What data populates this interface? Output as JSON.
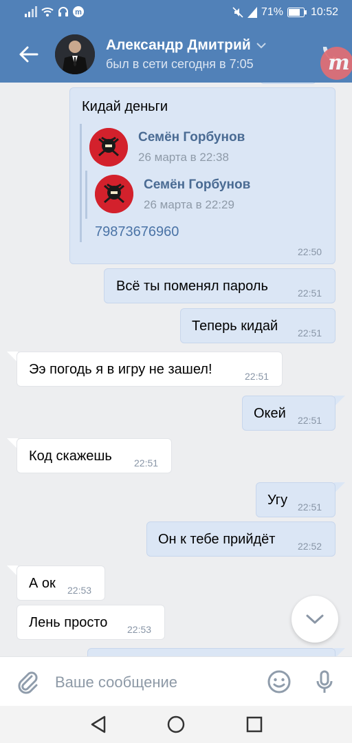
{
  "status": {
    "battery": "71%",
    "time": "10:52"
  },
  "header": {
    "title": "Александр Дмитрий",
    "subtitle": "был в сети сегодня в 7:05"
  },
  "messages": {
    "m0": {
      "text": "Кидай деньги",
      "time": "22:50",
      "forward1": {
        "name": "Семён Горбунов",
        "date": "26 марта в 22:38"
      },
      "forward2": {
        "name": "Семён Горбунов",
        "date": "26 марта в 22:29",
        "link": "79873676960"
      }
    },
    "m1": {
      "text": "Всё ты поменял пароль",
      "time": "22:51"
    },
    "m2": {
      "text": "Теперь кидай",
      "time": "22:51"
    },
    "m3": {
      "text": "Ээ погодь я в игру не зашел!",
      "time": "22:51"
    },
    "m4": {
      "text": "Окей",
      "time": "22:51"
    },
    "m5": {
      "text": "Код скажешь",
      "time": "22:51"
    },
    "m6": {
      "text": "Угу",
      "time": "22:51"
    },
    "m7": {
      "text": "Он к тебе прийдёт",
      "time": "22:52"
    },
    "m8": {
      "text": "А ок",
      "time": "22:53"
    },
    "m9": {
      "text": "Лень просто",
      "time": "22:53"
    }
  },
  "composer": {
    "placeholder": "Ваше сообщение"
  },
  "colors": {
    "header": "#5181b8",
    "outgoing": "#dbe6f5",
    "incoming": "#ffffff",
    "background": "#edeef0"
  }
}
